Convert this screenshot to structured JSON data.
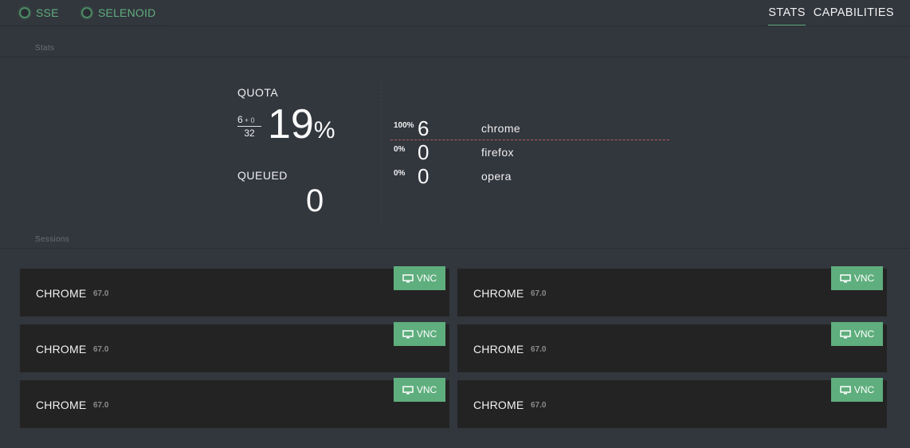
{
  "header": {
    "status": [
      {
        "label": "SSE"
      },
      {
        "label": "SELENOID"
      }
    ],
    "nav": [
      {
        "label": "STATS",
        "active": true
      },
      {
        "label": "CAPABILITIES",
        "active": false
      }
    ]
  },
  "stats": {
    "title": "Stats",
    "quota": {
      "label": "QUOTA",
      "used": "6",
      "pending": "+ 0",
      "total": "32",
      "percent": "19",
      "percent_sign": "%"
    },
    "queued": {
      "label": "QUEUED",
      "value": "0"
    },
    "browsers": [
      {
        "percent": "100%",
        "count": "6",
        "name": "chrome"
      },
      {
        "percent": "0%",
        "count": "0",
        "name": "firefox"
      },
      {
        "percent": "0%",
        "count": "0",
        "name": "opera"
      }
    ]
  },
  "sessions": {
    "title": "Sessions",
    "vnc_label": "VNC",
    "items": [
      {
        "browser": "CHROME",
        "version": "67.0"
      },
      {
        "browser": "CHROME",
        "version": "67.0"
      },
      {
        "browser": "CHROME",
        "version": "67.0"
      },
      {
        "browser": "CHROME",
        "version": "67.0"
      },
      {
        "browser": "CHROME",
        "version": "67.0"
      },
      {
        "browser": "CHROME",
        "version": "67.0"
      }
    ]
  },
  "colors": {
    "background": "#32363d",
    "accent": "#5fae7d",
    "card": "#232323",
    "quota_line": "#b85b5b"
  }
}
